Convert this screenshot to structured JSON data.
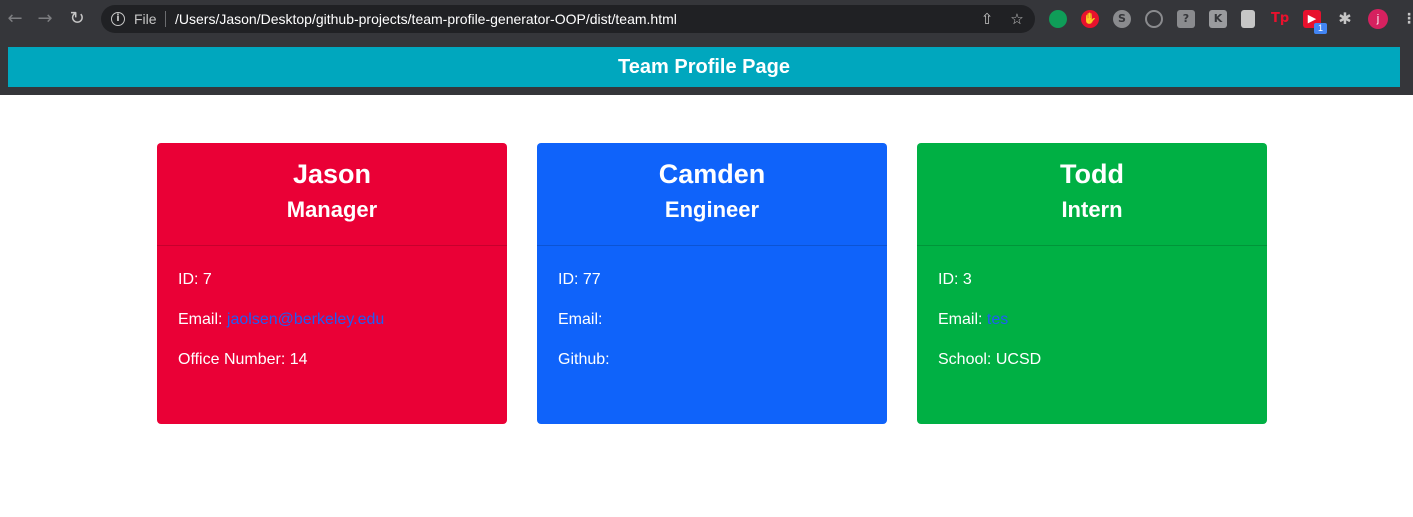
{
  "browser": {
    "back_icon": "arrow-left-icon",
    "forward_icon": "arrow-right-icon",
    "reload_icon": "reload-icon",
    "site_info_icon": "info-icon",
    "scheme_label": "File",
    "url": "/Users/Jason/Desktop/github-projects/team-profile-generator-OOP/dist/team.html",
    "extensions_badge": "1",
    "profile_initial": "j"
  },
  "page": {
    "title": "Team Profile Page"
  },
  "cards": [
    {
      "name": "Jason",
      "role": "Manager",
      "color": "#ea0036",
      "id_label": "ID:",
      "id_value": "7",
      "email_label": "Email:",
      "email_value": "jaolsen@berkeley.edu",
      "extra_label": "Office Number:",
      "extra_value": "14"
    },
    {
      "name": "Camden",
      "role": "Engineer",
      "color": "#0f63fa",
      "id_label": "ID:",
      "id_value": "77",
      "email_label": "Email:",
      "email_value": "",
      "extra_label": "Github:",
      "extra_value": ""
    },
    {
      "name": "Todd",
      "role": "Intern",
      "color": "#00b044",
      "id_label": "ID:",
      "id_value": "3",
      "email_label": "Email:",
      "email_value": "tes",
      "extra_label": "School:",
      "extra_value": "UCSD"
    }
  ],
  "colors": {
    "banner": "#00a7be",
    "link": "#1f5df5",
    "chrome": "#35363a"
  }
}
